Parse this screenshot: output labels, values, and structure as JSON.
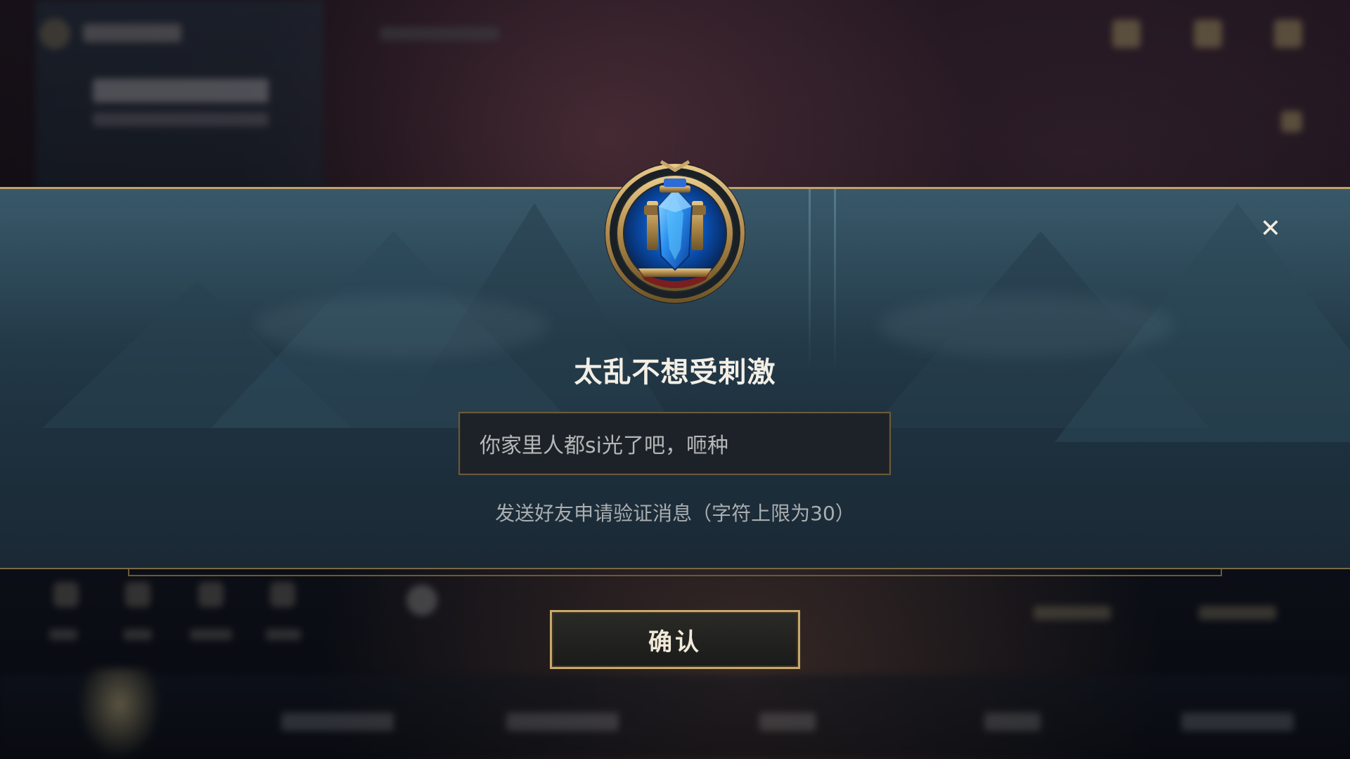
{
  "dialog": {
    "player_name": "太乱不想受刺激",
    "message_value": "你家里人都si光了吧，咂种",
    "hint": "发送好友申请验证消息（字符上限为30）",
    "close_symbol": "✕",
    "confirm_label": "确认"
  },
  "side_id": "3728823",
  "colors": {
    "gold_border": "#c2a26a",
    "dialog_top": "#365463",
    "dialog_bottom": "#1b2a36",
    "input_bg": "#1d2228",
    "text_primary": "#f3efe6",
    "text_muted": "#a9aeb0",
    "crystal": "#2f8de0"
  },
  "icons": {
    "close": "close-icon",
    "emblem": "crystal-emblem-icon"
  }
}
